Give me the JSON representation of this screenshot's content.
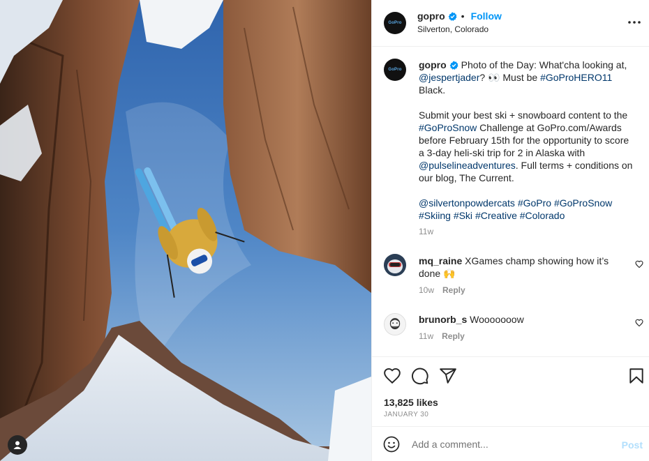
{
  "post": {
    "username": "gopro",
    "follow_label": "Follow",
    "separator": "•",
    "location": "Silverton, Colorado",
    "avatar_text": "GoPro"
  },
  "caption": {
    "username": "gopro",
    "p1_text": "Photo of the Day: What'cha looking at, ",
    "p1_mention": "@jespertjader",
    "p1_mid": "? 👀 Must be ",
    "p1_tag": "#GoProHERO11",
    "p1_end": " Black.",
    "p2_a": "Submit your best ski + snowboard content to the ",
    "p2_tag": "#GoProSnow",
    "p2_b": " Challenge at GoPro.com/Awards before February 15th for the opportunity to score a 3-day heli-ski trip for 2 in Alaska with ",
    "p2_mention": "@pulselineadventures",
    "p2_c": ". Full terms + conditions on our blog, The Current.",
    "tags": [
      "@silvertonpowdercats",
      "#GoPro",
      "#GoProSnow",
      "#Skiing",
      "#Ski",
      "#Creative",
      "#Colorado"
    ],
    "time": "11w"
  },
  "comments": [
    {
      "username": "mq_raine",
      "text": "XGames champ showing how it’s done 🙌",
      "time": "10w",
      "reply_label": "Reply"
    },
    {
      "username": "brunorb_s",
      "text": "Wooooooow",
      "time": "11w",
      "reply_label": "Reply"
    }
  ],
  "likes": "13,825 likes",
  "date": "JANUARY 30",
  "add_comment": {
    "placeholder": "Add a comment...",
    "post_label": "Post"
  },
  "colors": {
    "accent": "#0095f6",
    "link": "#00376b",
    "post_disabled": "#b2dffc",
    "muted": "#8e8e8e"
  },
  "icons": [
    "verified-badge-icon",
    "more-options-icon",
    "heart-icon",
    "comment-icon",
    "share-icon",
    "bookmark-icon",
    "emoji-icon",
    "user-tag-icon"
  ]
}
